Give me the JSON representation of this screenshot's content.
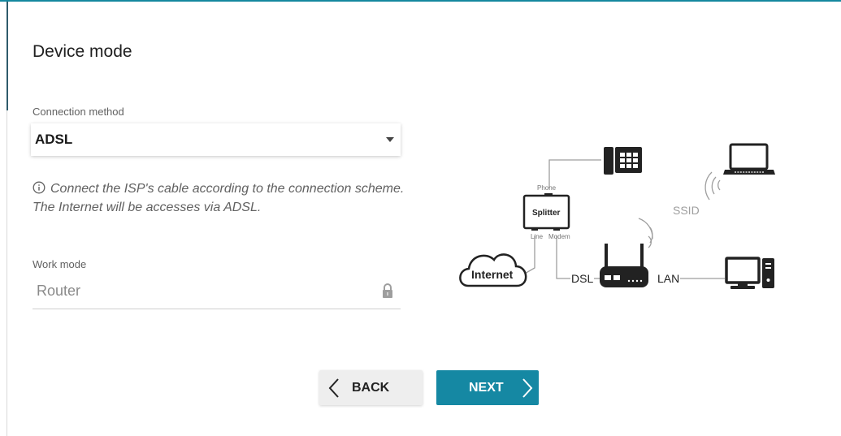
{
  "page": {
    "title": "Device mode"
  },
  "connection": {
    "label": "Connection method",
    "selected": "ADSL"
  },
  "info": {
    "text": "Connect the ISP's cable according to the connection scheme. The Internet will be accesses via ADSL."
  },
  "work_mode": {
    "label": "Work mode",
    "value": "Router"
  },
  "diagram": {
    "phone": "Phone",
    "splitter": "Splitter",
    "line": "Line",
    "modem": "Modem",
    "internet": "Internet",
    "dsl": "DSL",
    "lan": "LAN",
    "ssid": "SSID"
  },
  "buttons": {
    "back": "BACK",
    "next": "NEXT"
  },
  "colors": {
    "accent": "#1588a3",
    "top_bar": "#14889f",
    "diagram_line": "#9e9e9e"
  },
  "icons": [
    "info-icon",
    "lock-icon",
    "dropdown-caret-icon",
    "chevron-left-icon",
    "chevron-right-icon",
    "telephone-icon",
    "laptop-icon",
    "router-icon",
    "desktop-computer-icon",
    "cloud-icon",
    "wifi-signal-icon"
  ]
}
